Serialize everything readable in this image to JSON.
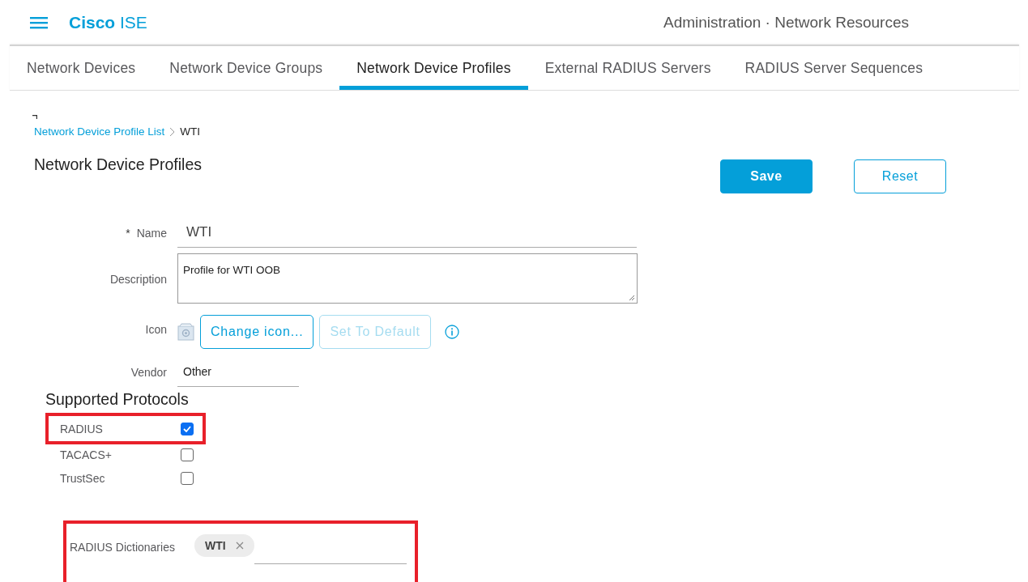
{
  "header": {
    "brand_bold": "Cisco",
    "brand_rest": "ISE",
    "context": "Administration · Network Resources"
  },
  "tabs": [
    {
      "label": "Network Devices",
      "selected": false
    },
    {
      "label": "Network Device Groups",
      "selected": false
    },
    {
      "label": "Network Device Profiles",
      "selected": true
    },
    {
      "label": "External RADIUS Servers",
      "selected": false
    },
    {
      "label": "RADIUS Server Sequences",
      "selected": false
    }
  ],
  "breadcrumb": {
    "link": "Network Device Profile List",
    "current": "WTI"
  },
  "page_title": "Network Device Profiles",
  "buttons": [
    {
      "label": "Save",
      "kind": "primary"
    },
    {
      "label": "Reset",
      "kind": "secondary"
    }
  ],
  "form": {
    "name_label": "Name",
    "required_mark": "*",
    "name_value": "WTI",
    "description_label": "Description",
    "description_value": "Profile for WTI OOB",
    "icon_label": "Icon",
    "change_icon": "Change icon...",
    "set_default": {
      "label": "Set To Default",
      "disabled": true
    },
    "vendor_label": "Vendor",
    "vendor_value": "Other"
  },
  "protocols_title": "Supported Protocols",
  "protocols": [
    {
      "label": "RADIUS",
      "checked": true,
      "highlighted": true
    },
    {
      "label": "TACACS+",
      "checked": false,
      "highlighted": false
    },
    {
      "label": "TrustSec",
      "checked": false,
      "highlighted": false
    }
  ],
  "dictionaries": {
    "label": "RADIUS Dictionaries",
    "highlighted": true,
    "chips": [
      {
        "label": "WTI"
      }
    ]
  }
}
